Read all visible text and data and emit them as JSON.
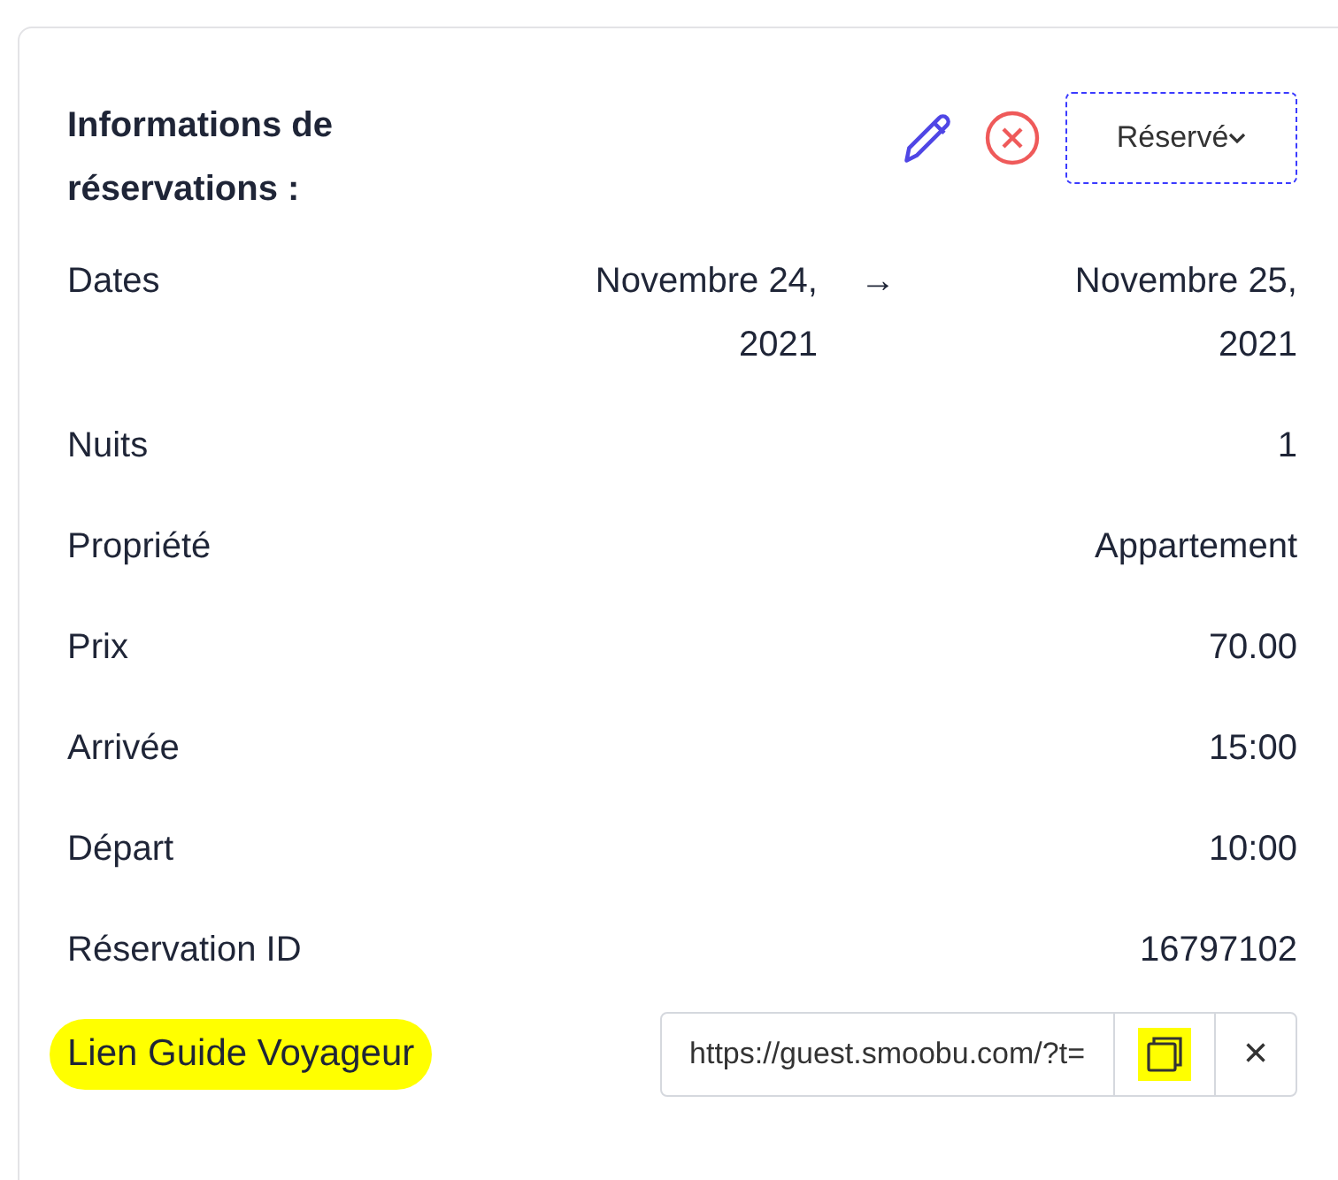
{
  "header": {
    "title": "Informations de réservations :",
    "status": "Réservé"
  },
  "dates": {
    "label": "Dates",
    "start": "Novembre 24, 2021",
    "arrow": "→",
    "end": "Novembre 25, 2021"
  },
  "rows": [
    {
      "label": "Nuits",
      "value": "1"
    },
    {
      "label": "Propriété",
      "value": "Appartement"
    },
    {
      "label": "Prix",
      "value": "70.00"
    },
    {
      "label": "Arrivée",
      "value": "15:00"
    },
    {
      "label": "Départ",
      "value": "10:00"
    },
    {
      "label": "Réservation ID",
      "value": "16797102"
    }
  ],
  "guide_link": {
    "label": "Lien Guide Voyageur",
    "label_highlighted": true,
    "value": "https://guest.smoobu.com/?t=",
    "copy_highlighted": true,
    "clear": "×"
  }
}
